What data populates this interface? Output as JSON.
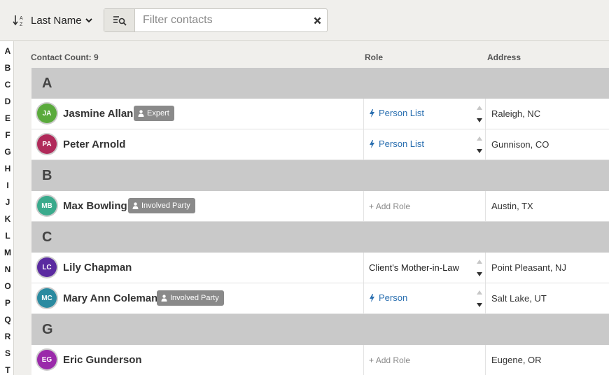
{
  "toolbar": {
    "sort_icon": "sort-alpha-icon",
    "sort_label": "Last Name",
    "filter_icon": "filter-list-search-icon",
    "filter_placeholder": "Filter contacts",
    "filter_value": "",
    "clear_icon": "close-icon"
  },
  "alphabet": [
    "A",
    "B",
    "C",
    "D",
    "E",
    "F",
    "G",
    "H",
    "I",
    "J",
    "K",
    "L",
    "M",
    "N",
    "O",
    "P",
    "Q",
    "R",
    "S",
    "T"
  ],
  "table": {
    "contact_count_label": "Contact Count: 9",
    "role_header": "Role",
    "address_header": "Address"
  },
  "groups": [
    {
      "letter": "A"
    },
    {
      "letter": "B"
    },
    {
      "letter": "C"
    },
    {
      "letter": "G"
    }
  ],
  "contacts": [
    {
      "initials": "JA",
      "name": "Jasmine Allan",
      "avatar_color": "#5aaa3c",
      "tag": "Expert",
      "role_kind": "link",
      "role": "Person List",
      "address": "Raleigh, NC"
    },
    {
      "initials": "PA",
      "name": "Peter Arnold",
      "avatar_color": "#b02a5a",
      "tag": "",
      "role_kind": "link",
      "role": "Person List",
      "address": "Gunnison, CO"
    },
    {
      "initials": "MB",
      "name": "Max Bowling",
      "avatar_color": "#3aaa8c",
      "tag": "Involved Party",
      "role_kind": "add",
      "role": "Add Role",
      "address": "Austin, TX"
    },
    {
      "initials": "LC",
      "name": "Lily Chapman",
      "avatar_color": "#5a2aa0",
      "tag": "",
      "role_kind": "text",
      "role": "Client's Mother-in-Law",
      "address": "Point Pleasant, NJ"
    },
    {
      "initials": "MC",
      "name": "Mary Ann Coleman",
      "avatar_color": "#2a8aa0",
      "tag": "Involved Party",
      "role_kind": "link",
      "role": "Person",
      "address": "Salt Lake, UT"
    },
    {
      "initials": "EG",
      "name": "Eric Gunderson",
      "avatar_color": "#9a2aaa",
      "tag": "",
      "role_kind": "add",
      "role": "Add Role",
      "address": "Eugene, OR"
    }
  ],
  "colors": {
    "link": "#2a6fb0",
    "group_band": "#c9c9c9",
    "tag_bg": "#8a8a8a",
    "page_bg": "#f0efec"
  }
}
